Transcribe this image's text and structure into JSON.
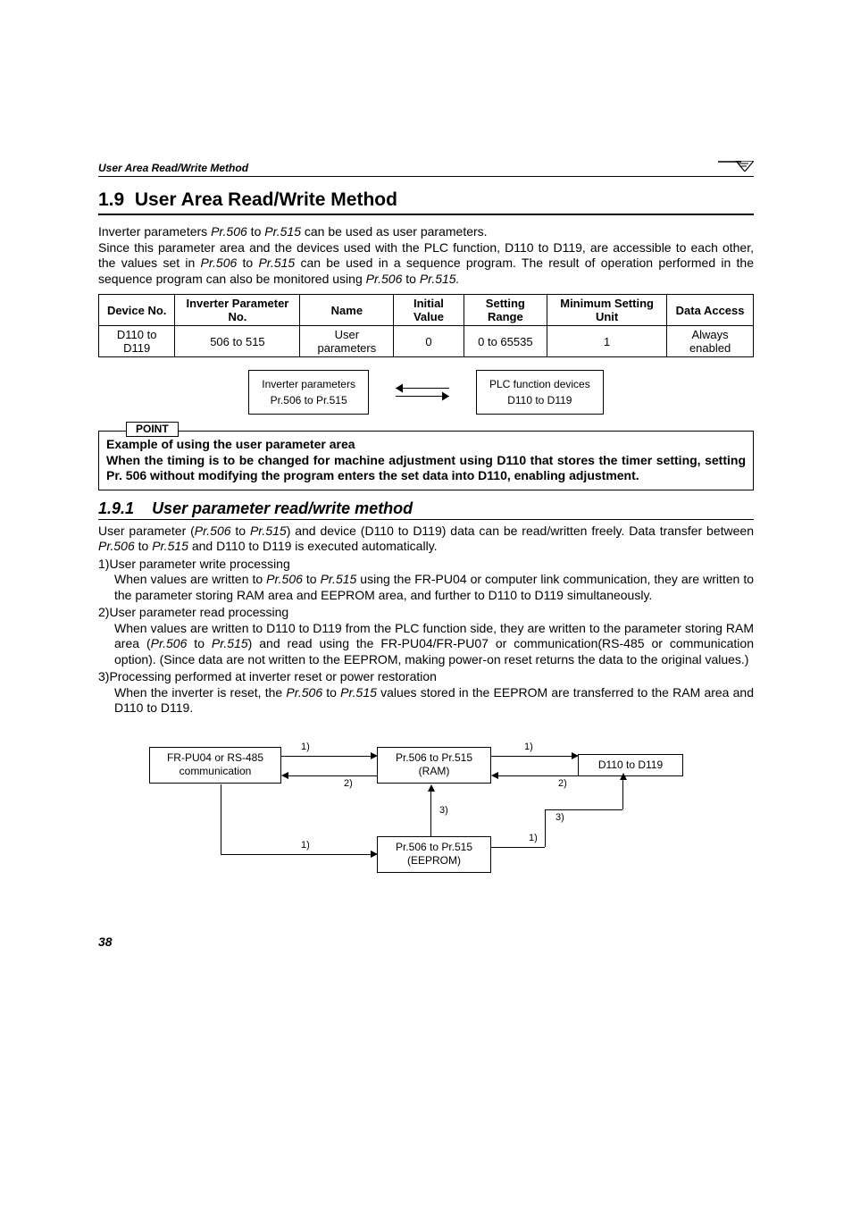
{
  "running_head": "User Area Read/Write Method",
  "section": {
    "number": "1.9",
    "title": "User Area Read/Write Method"
  },
  "intro": {
    "l1a": "Inverter parameters ",
    "l1b": "Pr.506",
    "l1c": " to ",
    "l1d": "Pr.515",
    "l1e": " can be used as user parameters.",
    "l2a": "Since this parameter area and the devices used with the PLC function, D110 to D119, are accessible to each other, the values set in ",
    "l2b": "Pr.506",
    "l2c": " to ",
    "l2d": "Pr.515",
    "l2e": " can be used in a sequence program. The result of operation performed in the sequence program can also be monitored using ",
    "l2f": "Pr.506",
    "l2g": " to ",
    "l2h": "Pr.515."
  },
  "table": {
    "headers": {
      "c1": "Device No.",
      "c2": "Inverter Parameter No.",
      "c3": "Name",
      "c4": "Initial Value",
      "c5": "Setting Range",
      "c6": "Minimum Setting Unit",
      "c7": "Data Access"
    },
    "row": {
      "c1": "D110 to D119",
      "c2": "506 to 515",
      "c3": "User parameters",
      "c4": "0",
      "c5": "0 to 65535",
      "c6": "1",
      "c7": "Always enabled"
    }
  },
  "diagram1": {
    "left_top": "Inverter parameters",
    "left_bottom": "Pr.506 to Pr.515",
    "right_top": "PLC function devices",
    "right_bottom": "D110 to D119"
  },
  "point": {
    "label": "POINT",
    "l1": "Example of using the user parameter area",
    "l2": "When the timing is to be changed for machine adjustment using D110 that stores the timer setting, setting Pr. 506 without modifying the program enters the set data into D110, enabling adjustment."
  },
  "subsection": {
    "number": "1.9.1",
    "title": "User parameter read/write method"
  },
  "sub_intro": {
    "a": "User parameter (",
    "b": "Pr.506",
    "c": " to ",
    "d": "Pr.515",
    "e": ") and device (D110 to D119) data can be read/written freely. Data transfer between ",
    "f": "Pr.506",
    "g": " to ",
    "h": "Pr.515",
    "i": " and D110 to D119 is executed automatically."
  },
  "list": {
    "i1": {
      "num": "1)",
      "title": "User parameter write processing",
      "d_a": "When values are written to ",
      "d_b": "Pr.506",
      "d_c": " to ",
      "d_d": "Pr.515",
      "d_e": " using the FR-PU04 or computer link communication, they are written to the parameter storing RAM area and EEPROM area, and further to D110 to D119 simultaneously."
    },
    "i2": {
      "num": "2)",
      "title": "User parameter read processing",
      "d_a": "When values are written to D110 to D119 from the PLC function side, they are written to the parameter storing RAM area (",
      "d_b": "Pr.506",
      "d_c": " to ",
      "d_d": "Pr.515",
      "d_e": ") and read using the FR-PU04/FR-PU07 or communication(RS-485 or communication option). (Since data are not written to the EEPROM, making power-on reset returns the data to the original values.)"
    },
    "i3": {
      "num": "3)",
      "title": "Processing performed at inverter reset or power restoration",
      "d_a": "When the inverter is reset, the ",
      "d_b": "Pr.506",
      "d_c": " to ",
      "d_d": "Pr.515",
      "d_e": " values stored in the EEPROM are transferred to the RAM area and D110 to D119."
    }
  },
  "diagram2": {
    "box1a": "FR-PU04 or RS-485",
    "box1b": "communication",
    "box2a": "Pr.506 to Pr.515",
    "box2b": "(RAM)",
    "box3": "D110 to D119",
    "box4a": "Pr.506 to Pr.515",
    "box4b": "(EEPROM)",
    "lbl1": "1)",
    "lbl2": "2)",
    "lbl3": "3)"
  },
  "page_number": "38"
}
